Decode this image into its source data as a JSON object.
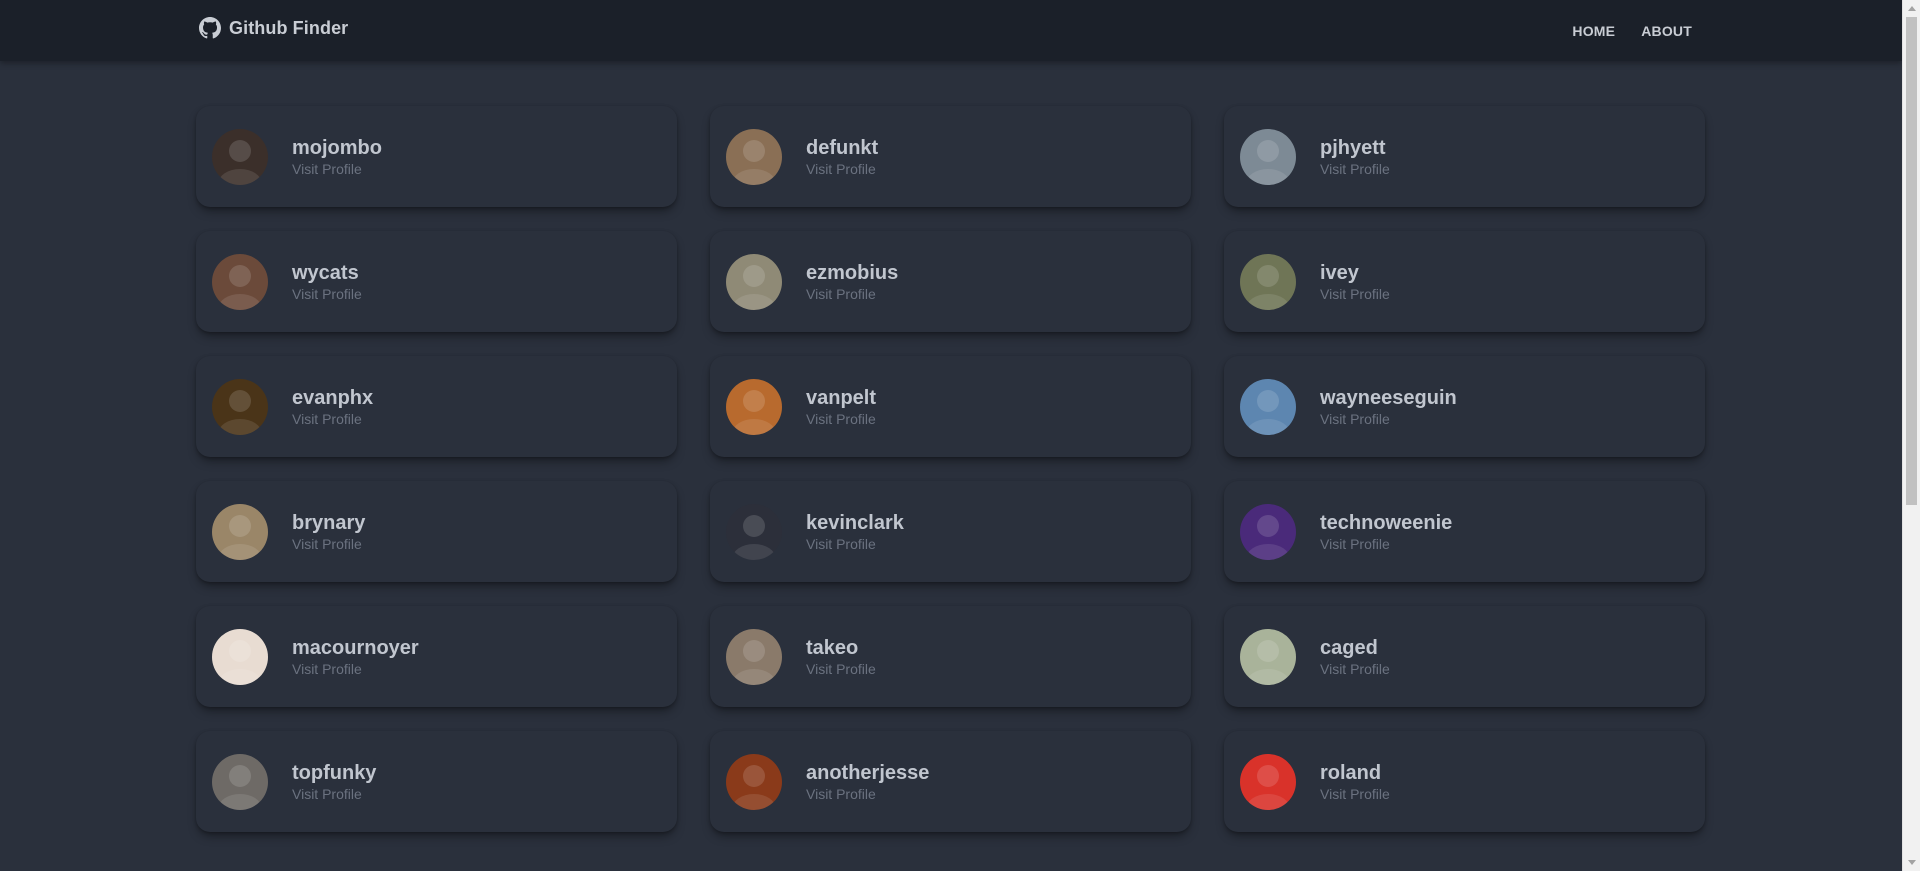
{
  "navbar": {
    "brand_icon": "github-icon",
    "title": "Github Finder",
    "links": [
      "HOME",
      "ABOUT"
    ]
  },
  "users": [
    {
      "login": "mojombo",
      "link_label": "Visit Profile",
      "avatar_color": "#3b2f2a"
    },
    {
      "login": "defunkt",
      "link_label": "Visit Profile",
      "avatar_color": "#8a6f55"
    },
    {
      "login": "pjhyett",
      "link_label": "Visit Profile",
      "avatar_color": "#7d8a95"
    },
    {
      "login": "wycats",
      "link_label": "Visit Profile",
      "avatar_color": "#6b4a3a"
    },
    {
      "login": "ezmobius",
      "link_label": "Visit Profile",
      "avatar_color": "#8f8a76"
    },
    {
      "login": "ivey",
      "link_label": "Visit Profile",
      "avatar_color": "#6f7556"
    },
    {
      "login": "evanphx",
      "link_label": "Visit Profile",
      "avatar_color": "#4a3418"
    },
    {
      "login": "vanpelt",
      "link_label": "Visit Profile",
      "avatar_color": "#b86a2e"
    },
    {
      "login": "wayneeseguin",
      "link_label": "Visit Profile",
      "avatar_color": "#5d86b0"
    },
    {
      "login": "brynary",
      "link_label": "Visit Profile",
      "avatar_color": "#9a8668"
    },
    {
      "login": "kevinclark",
      "link_label": "Visit Profile",
      "avatar_color": "#2c2f3a"
    },
    {
      "login": "technoweenie",
      "link_label": "Visit Profile",
      "avatar_color": "#4a2a7a"
    },
    {
      "login": "macournoyer",
      "link_label": "Visit Profile",
      "avatar_color": "#e8dcd2"
    },
    {
      "login": "takeo",
      "link_label": "Visit Profile",
      "avatar_color": "#8a7a6a"
    },
    {
      "login": "caged",
      "link_label": "Visit Profile",
      "avatar_color": "#a9b39a"
    },
    {
      "login": "topfunky",
      "link_label": "Visit Profile",
      "avatar_color": "#6e6a66"
    },
    {
      "login": "anotherjesse",
      "link_label": "Visit Profile",
      "avatar_color": "#8a3a1a"
    },
    {
      "login": "roland",
      "link_label": "Visit Profile",
      "avatar_color": "#d9322a"
    }
  ],
  "theme": {
    "background": "#2a303c",
    "navbar": "#1b2029",
    "text": "#c1c6cf",
    "muted": "#6b7280"
  }
}
